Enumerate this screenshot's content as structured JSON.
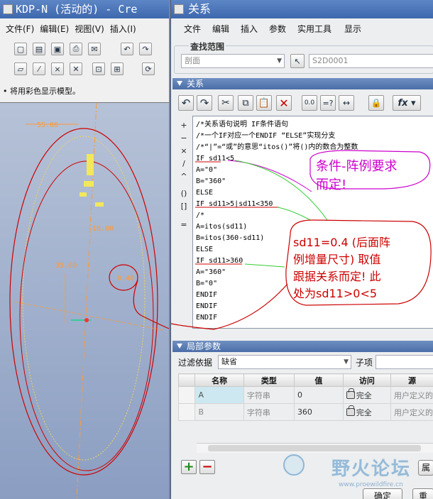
{
  "left_window": {
    "title": "KDP-N (活动的) - Cre",
    "menu": [
      "文件(F)",
      "编辑(E)",
      "视图(V)",
      "插入(I)"
    ],
    "status_hint": "将用彩色显示模型。",
    "dimensions": [
      "55.00",
      "35.00",
      "16.00",
      "0.40"
    ]
  },
  "dialog": {
    "title": "关系",
    "menu": [
      "文件",
      "编辑",
      "插入",
      "参数",
      "实用工具",
      "显示"
    ],
    "search_range": {
      "label": "查找范围",
      "type_value": "剖面",
      "name_value": "S2D0001"
    },
    "relations": {
      "section_title": "关系",
      "operators": [
        "+",
        "−",
        "×",
        "/",
        "^",
        "()",
        "[]",
        "="
      ],
      "lines": [
        "/*关系语句说明 IF条件语句",
        "/*一个IF对应一个ENDIF “ELSE”实现分支",
        "/*“|”=“或”的意思“itos()”将()内的数合为整数",
        "IF sd11<5",
        "A=\"0\"",
        "B=\"360\"",
        "ELSE",
        "IF sd11>5|sd11<350",
        "/*",
        "A=itos(sd11)",
        "B=itos(360-sd11)",
        "ELSE",
        "IF sd11>360",
        "A=\"360\"",
        "B=\"0\"",
        "ENDIF",
        "ENDIF",
        "ENDIF"
      ]
    },
    "local_params": {
      "section_title": "局部参数",
      "filter_label": "过滤依据",
      "filter_value": "缺省",
      "subitem_label": "子项",
      "columns": [
        "名称",
        "类型",
        "值",
        "访问",
        "源"
      ],
      "rows": [
        {
          "name": "A",
          "type": "字符串",
          "value": "0",
          "access": "完全",
          "source": "用户定义的"
        },
        {
          "name": "B",
          "type": "字符串",
          "value": "360",
          "access": "完全",
          "source": "用户定义的"
        }
      ],
      "add_symbol": "+",
      "remove_symbol": "−",
      "extra_button": "属"
    },
    "ok_button": "确定",
    "reset_button": "重"
  },
  "annotations": {
    "callout_1": [
      "条件-阵例要求",
      "而定!"
    ],
    "callout_2": [
      "sd11=0.4 (后面阵",
      "例增量尺寸) 取值",
      "跟据关系而定! 此",
      "处为sd11>0<5"
    ]
  },
  "watermark": {
    "name": "野火论坛",
    "url": "www.proewildfire.cn"
  },
  "colors": {
    "title_blue": "#4a72b5",
    "annotation_red": "#cc0000",
    "annotation_magenta": "#cc00cc",
    "arrow_green": "#33cc33"
  }
}
